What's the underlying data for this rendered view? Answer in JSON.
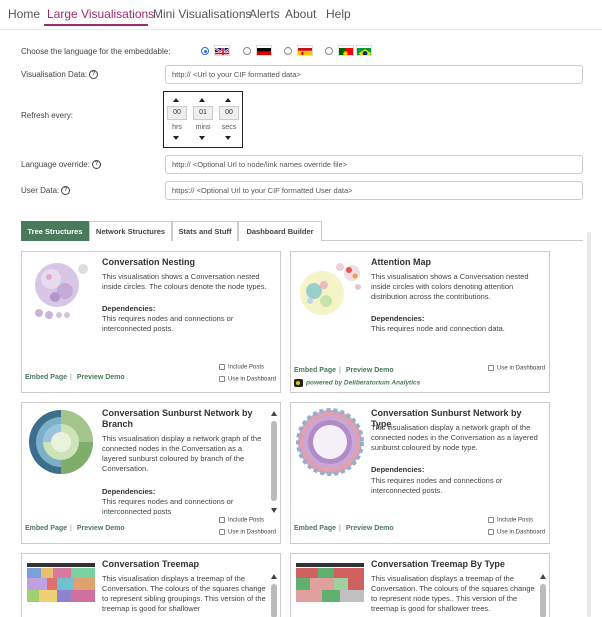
{
  "nav": {
    "items": [
      {
        "label": "Home"
      },
      {
        "label": "Large Visualisations"
      },
      {
        "label": "Mini Visualisations"
      },
      {
        "label": "Alerts"
      },
      {
        "label": "About"
      },
      {
        "label": "Help"
      }
    ],
    "active_index": 1,
    "active_color": "#9b2d70"
  },
  "form": {
    "language_label": "Choose the language for the embeddable:",
    "languages": [
      {
        "flag": "uk-flag",
        "selected": true
      },
      {
        "flag": "de-flag",
        "selected": false
      },
      {
        "flag": "es-flag",
        "selected": false
      },
      {
        "flag": "pt-br-flag",
        "selected": false
      }
    ],
    "vis_data_label": "Visualisation Data:",
    "vis_data_placeholder": "http:// <Url to your CIF formatted data>",
    "refresh_label": "Refresh every:",
    "refresh": {
      "hrs": {
        "value": "00",
        "unit": "hrs"
      },
      "mins": {
        "value": "01",
        "unit": "mins"
      },
      "secs": {
        "value": "00",
        "unit": "secs"
      }
    },
    "lang_override_label": "Language override:",
    "lang_override_placeholder": "http:// <Optional Url to node/link names override file>",
    "user_data_label": "User Data:",
    "user_data_placeholder": "https:// <Optional Url to your CIF formatted User data>",
    "help_glyph": "?"
  },
  "tabs": [
    {
      "label": "Tree Structures",
      "active": true
    },
    {
      "label": "Network Structures",
      "active": false
    },
    {
      "label": "Stats and Stuff",
      "active": false
    },
    {
      "label": "Dashboard Builder",
      "active": false
    }
  ],
  "cards": [
    {
      "title": "Conversation Nesting",
      "description": "This visualisation shows a Conversation nested inside circles. The colours denote the node types.",
      "dep_heading": "Dependencies:",
      "dependencies": "This requires nodes and connections or interconnected posts.",
      "links": {
        "embed": "Embed",
        "page": "Page",
        "preview": "Preview",
        "demo": "Demo"
      },
      "checks": [
        "Include Posts",
        "Use in Dashboard"
      ]
    },
    {
      "title": "Attention Map",
      "description": "This visualisation shows a Conversation nested inside circles with colors denoting attention distribution across the contributions.",
      "dep_heading": "Dependencies:",
      "dependencies": "This requires node and connection data.",
      "links": {
        "embed": "Embed",
        "page": "Page",
        "preview": "Preview",
        "demo": "Demo"
      },
      "checks": [
        "Use in Dashboard"
      ],
      "powered": "powered by Deliberatorium Analytics"
    },
    {
      "title": "Conversation Sunburst Network by Branch",
      "description": "This visualisation display a network graph of the connected nodes in the Conversation as a layered sunburst coloured by branch of the Conversation.",
      "dep_heading": "Dependencies:",
      "dependencies": "This requires nodes and connections or interconnected posts",
      "links": {
        "embed": "Embed",
        "page": "Page",
        "preview": "Preview",
        "demo": "Demo"
      },
      "checks": [
        "Include Posts",
        "Use in Dashboard"
      ]
    },
    {
      "title": "Conversation Sunburst Network by Type",
      "description": "This visualisation display a network graph of the connected nodes in the Conversation as a layered sunburst coloured by node type.",
      "dep_heading": "Dependencies:",
      "dependencies": "This requires nodes and connections or interconnected posts.",
      "links": {
        "embed": "Embed",
        "page": "Page",
        "preview": "Preview",
        "demo": "Demo"
      },
      "checks": [
        "Include Posts",
        "Use in Dashboard"
      ]
    },
    {
      "title": "Conversation Treemap",
      "description": "This visualisation displays a treemap of the Conversation. The colours of the squares change to represent sibling groupings. This version of the treemap is good for shallower"
    },
    {
      "title": "Conversation Treemap By Type",
      "description": "This visualisation displays a treemap of the Conversation. The colours of the squares change to represent node types.. This version of the treemap is good for shallower trees."
    }
  ],
  "colors": {
    "accent_green": "#4a7a5c",
    "accent_purple": "#9b2d70"
  }
}
